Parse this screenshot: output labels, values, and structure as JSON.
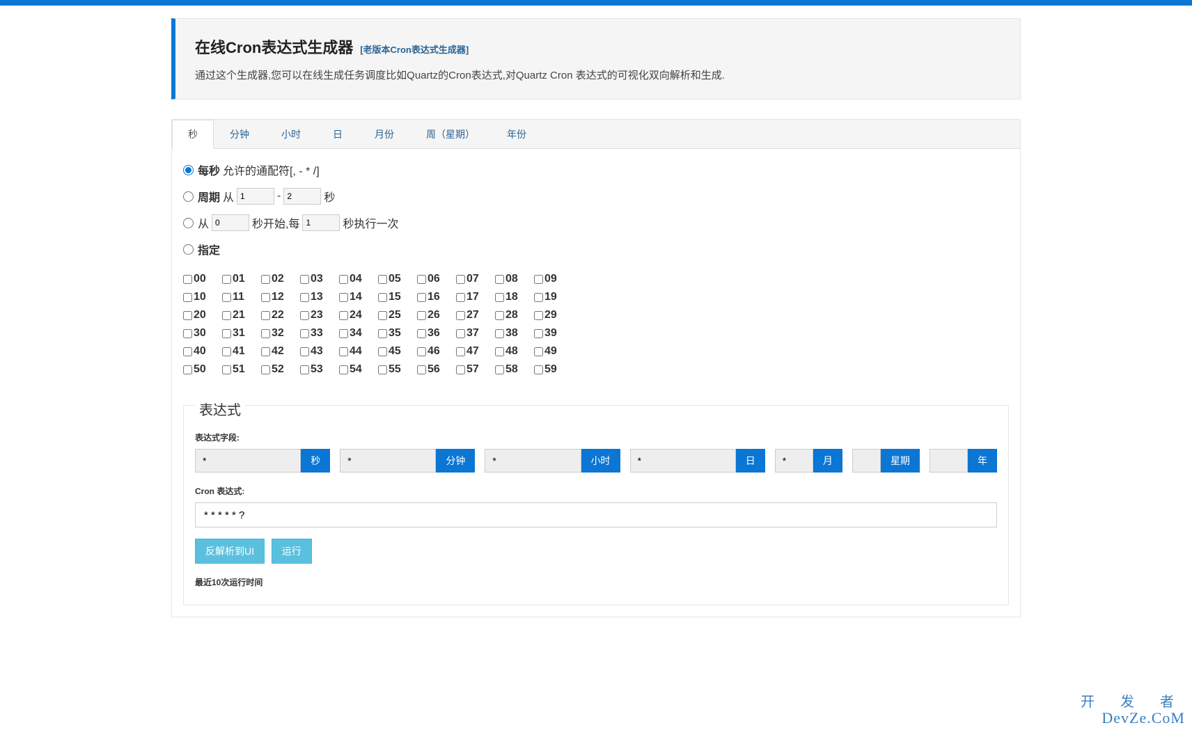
{
  "header": {
    "title": "在线Cron表达式生成器",
    "old_version_link": "[老版本Cron表达式生成器]",
    "description": "通过这个生成器,您可以在线生成任务调度比如Quartz的Cron表达式,对Quartz Cron 表达式的可视化双向解析和生成."
  },
  "tabs": [
    "秒",
    "分钟",
    "小时",
    "日",
    "月份",
    "周（星期）",
    "年份"
  ],
  "seconds_panel": {
    "opt1_bold": "每秒",
    "opt1_rest": " 允许的通配符[, - * /]",
    "opt2_bold": "周期",
    "opt2_from": " 从 ",
    "opt2_val1": "1",
    "opt2_dash": " - ",
    "opt2_val2": "2",
    "opt2_unit": " 秒",
    "opt3_from": "从 ",
    "opt3_val1": "0",
    "opt3_mid": " 秒开始,每 ",
    "opt3_val2": "1",
    "opt3_end": " 秒执行一次",
    "opt4_bold": "指定",
    "checkboxes": [
      "00",
      "01",
      "02",
      "03",
      "04",
      "05",
      "06",
      "07",
      "08",
      "09",
      "10",
      "11",
      "12",
      "13",
      "14",
      "15",
      "16",
      "17",
      "18",
      "19",
      "20",
      "21",
      "22",
      "23",
      "24",
      "25",
      "26",
      "27",
      "28",
      "29",
      "30",
      "31",
      "32",
      "33",
      "34",
      "35",
      "36",
      "37",
      "38",
      "39",
      "40",
      "41",
      "42",
      "43",
      "44",
      "45",
      "46",
      "47",
      "48",
      "49",
      "50",
      "51",
      "52",
      "53",
      "54",
      "55",
      "56",
      "57",
      "58",
      "59"
    ]
  },
  "expression": {
    "title": "表达式",
    "fields_label": "表达式字段:",
    "fields": [
      {
        "value": "*",
        "label": "秒"
      },
      {
        "value": "*",
        "label": "分钟"
      },
      {
        "value": "*",
        "label": "小时"
      },
      {
        "value": "*",
        "label": "日"
      },
      {
        "value": "*",
        "label": "月"
      },
      {
        "value": "",
        "label": "星期"
      },
      {
        "value": "",
        "label": "年"
      }
    ],
    "cron_label": "Cron 表达式:",
    "cron_value": "* * * * * ?",
    "btn_parse": "反解析到UI",
    "btn_run": "运行",
    "recent_label": "最近10次运行时间"
  },
  "watermark": {
    "cn": "开 发 者",
    "en": "DevZe.CoM"
  }
}
